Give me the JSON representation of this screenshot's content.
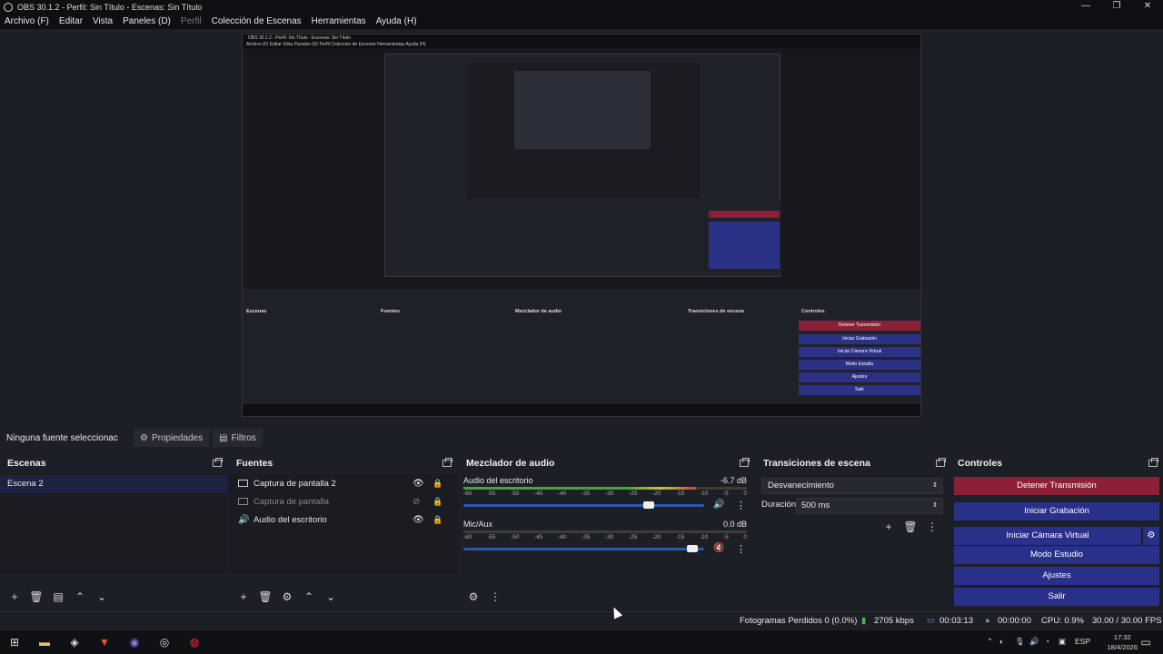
{
  "window": {
    "title": "OBS 30.1.2 - Perfil: Sin Título - Escenas: Sin Título",
    "minimize": "—",
    "maximize": "❐",
    "close": "✕"
  },
  "menu": {
    "items": [
      "Archivo (F)",
      "Editar",
      "Vista",
      "Paneles (D)",
      "Perfil",
      "Colección de Escenas",
      "Herramientas",
      "Ayuda (H)"
    ],
    "disabled_index": 4
  },
  "preview": {
    "nested_title": "OBS 30.1.2 - Perfil: Sin Título - Escenas: Sin Título",
    "nested_menu": "Archivo (F)   Editar   Vista   Paneles (D)   Perfil   Colección de Escenas   Herramientas   Ayuda (H)",
    "nested_panels": [
      "Escenas",
      "Fuentes",
      "Mezclador de audio",
      "Transiciones de escena",
      "Controles"
    ],
    "nested_buttons": [
      "Detener Transmisión",
      "Iniciar Grabación",
      "Iniciar Cámara Virtual",
      "Modo Estudio",
      "Ajustes",
      "Salir"
    ]
  },
  "toolbar": {
    "no_source": "Ninguna fuente seleccionac",
    "properties": "Propiedades",
    "filters": "Filtros"
  },
  "scenes": {
    "title": "Escenas",
    "items": [
      "Escena 2"
    ]
  },
  "sources": {
    "title": "Fuentes",
    "items": [
      {
        "name": "Captura de pantalla 2",
        "type": "monitor",
        "visible": true
      },
      {
        "name": "Captura de pantalla",
        "type": "monitor",
        "visible": false
      },
      {
        "name": "Audio del escritorio",
        "type": "speaker",
        "visible": true
      }
    ]
  },
  "mixer": {
    "title": "Mezclador de audio",
    "ticks": [
      "-60",
      "-55",
      "-50",
      "-45",
      "-40",
      "-35",
      "-30",
      "-25",
      "-20",
      "-15",
      "-10",
      "-5",
      "0"
    ],
    "tracks": [
      {
        "name": "Audio del escritorio",
        "db": "-6.7 dB",
        "level": 0.82,
        "volume": 0.77,
        "muted": false
      },
      {
        "name": "Mic/Aux",
        "db": "0.0 dB",
        "level": 0,
        "volume": 0.95,
        "muted": true
      }
    ]
  },
  "transitions": {
    "title": "Transiciones de escena",
    "selected": "Desvanecimiento",
    "duration_label": "Duración",
    "duration_value": "500 ms"
  },
  "controls": {
    "title": "Controles",
    "stop_stream": "Detener Transmisión",
    "start_recording": "Iniciar Grabación",
    "start_virtual_cam": "Iniciar Cámara Virtual",
    "studio_mode": "Modo Estudio",
    "settings": "Ajustes",
    "exit": "Salir"
  },
  "status": {
    "dropped": "Fotogramas Perdidos 0 (0.0%)",
    "bitrate": "2705 kbps",
    "stream_time": "00:03:13",
    "rec_time": "00:00:00",
    "cpu": "CPU: 0.9%",
    "fps": "30.00 / 30.00 FPS"
  },
  "taskbar": {
    "lang": "ESP",
    "time": "17:32",
    "date": "18/4/2026"
  },
  "colors": {
    "accent": "#28308a",
    "stop": "#8c2036",
    "bg": "#1d1f26"
  }
}
